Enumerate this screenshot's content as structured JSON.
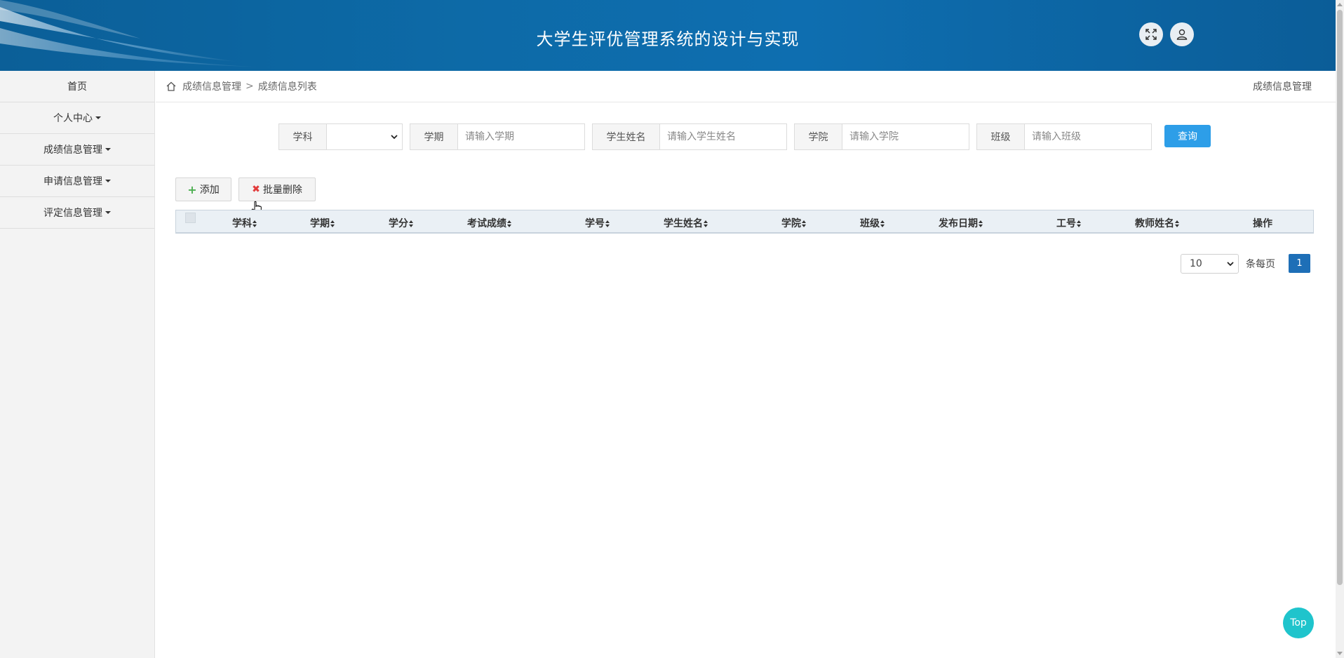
{
  "header": {
    "title": "大学生评优管理系统的设计与实现",
    "fullscreen_icon": "fullscreen-icon",
    "user_icon": "user-icon"
  },
  "sidebar": {
    "items": [
      {
        "label": "首页",
        "dropdown": false
      },
      {
        "label": "个人中心",
        "dropdown": true
      },
      {
        "label": "成绩信息管理",
        "dropdown": true
      },
      {
        "label": "申请信息管理",
        "dropdown": true
      },
      {
        "label": "评定信息管理",
        "dropdown": true
      }
    ]
  },
  "breadcrumb": {
    "home_icon": "home-icon",
    "level1": "成绩信息管理",
    "separator": ">",
    "level2": "成绩信息列表",
    "right_title": "成绩信息管理"
  },
  "search": {
    "subject_label": "学科",
    "subject_value": "",
    "term_label": "学期",
    "term_placeholder": "请输入学期",
    "student_name_label": "学生姓名",
    "student_name_placeholder": "请输入学生姓名",
    "college_label": "学院",
    "college_placeholder": "请输入学院",
    "class_label": "班级",
    "class_placeholder": "请输入班级",
    "query_button": "查询"
  },
  "actions": {
    "add_label": "添加",
    "batch_delete_label": "批量删除"
  },
  "table": {
    "columns": [
      "学科",
      "学期",
      "学分",
      "考试成绩",
      "学号",
      "学生姓名",
      "学院",
      "班级",
      "发布日期",
      "工号",
      "教师姓名",
      "操作"
    ],
    "rows": []
  },
  "pagination": {
    "page_size": "10",
    "per_page_label": "条每页",
    "current_page": "1"
  },
  "top_button": "Top",
  "colors": {
    "header_bg": "#0d6aa7",
    "query_button": "#2d9ee8",
    "page_active": "#1e6fb7",
    "top_button": "#1fc4cc"
  }
}
